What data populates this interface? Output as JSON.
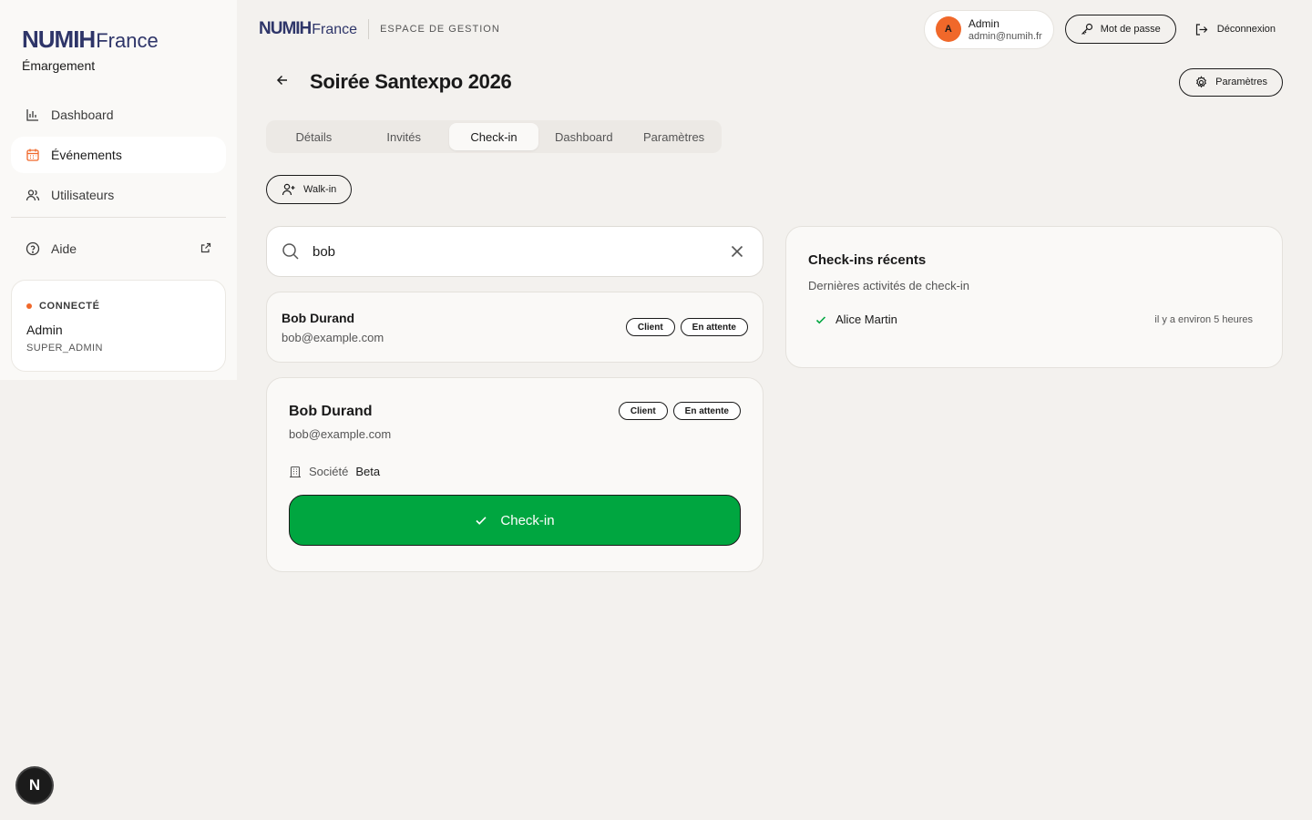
{
  "sidebar": {
    "brand_numih": "NUMIH",
    "brand_france": "France",
    "subtitle": "Émargement",
    "items": [
      {
        "label": "Dashboard",
        "icon": "bar-chart-icon"
      },
      {
        "label": "Événements",
        "icon": "calendar-icon"
      },
      {
        "label": "Utilisateurs",
        "icon": "users-icon"
      },
      {
        "label": "Aide",
        "icon": "help-circle-icon"
      }
    ],
    "status": {
      "label": "CONNECTÉ",
      "name": "Admin",
      "role": "SUPER_ADMIN"
    }
  },
  "n_badge": "N",
  "topbar": {
    "brand_numih": "NUMIH",
    "brand_france": "France",
    "label": "ESPACE DE GESTION",
    "user": {
      "initial": "A",
      "name": "Admin",
      "email": "admin@numih.fr"
    },
    "password_label": "Mot de passe",
    "logout_label": "Déconnexion"
  },
  "page": {
    "title": "Soirée Santexpo 2026",
    "settings_label": "Paramètres"
  },
  "tabs": [
    {
      "label": "Détails"
    },
    {
      "label": "Invités"
    },
    {
      "label": "Check-in"
    },
    {
      "label": "Dashboard"
    },
    {
      "label": "Paramètres"
    }
  ],
  "walkin_label": "Walk-in",
  "search": {
    "value": "bob"
  },
  "result": {
    "name": "Bob Durand",
    "email": "bob@example.com",
    "badges": [
      "Client",
      "En attente"
    ]
  },
  "detail": {
    "name": "Bob Durand",
    "email": "bob@example.com",
    "badges": [
      "Client",
      "En attente"
    ],
    "company_label": "Société",
    "company_value": "Beta",
    "checkin_label": "Check-in"
  },
  "recent": {
    "title": "Check-ins récents",
    "subtitle": "Dernières activités de check-in",
    "items": [
      {
        "name": "Alice Martin",
        "time": "il y a environ 5 heures"
      }
    ]
  },
  "colors": {
    "accent": "#f0682a",
    "brand": "#2e3569",
    "success": "#00a640",
    "background": "#f3f1ee"
  }
}
